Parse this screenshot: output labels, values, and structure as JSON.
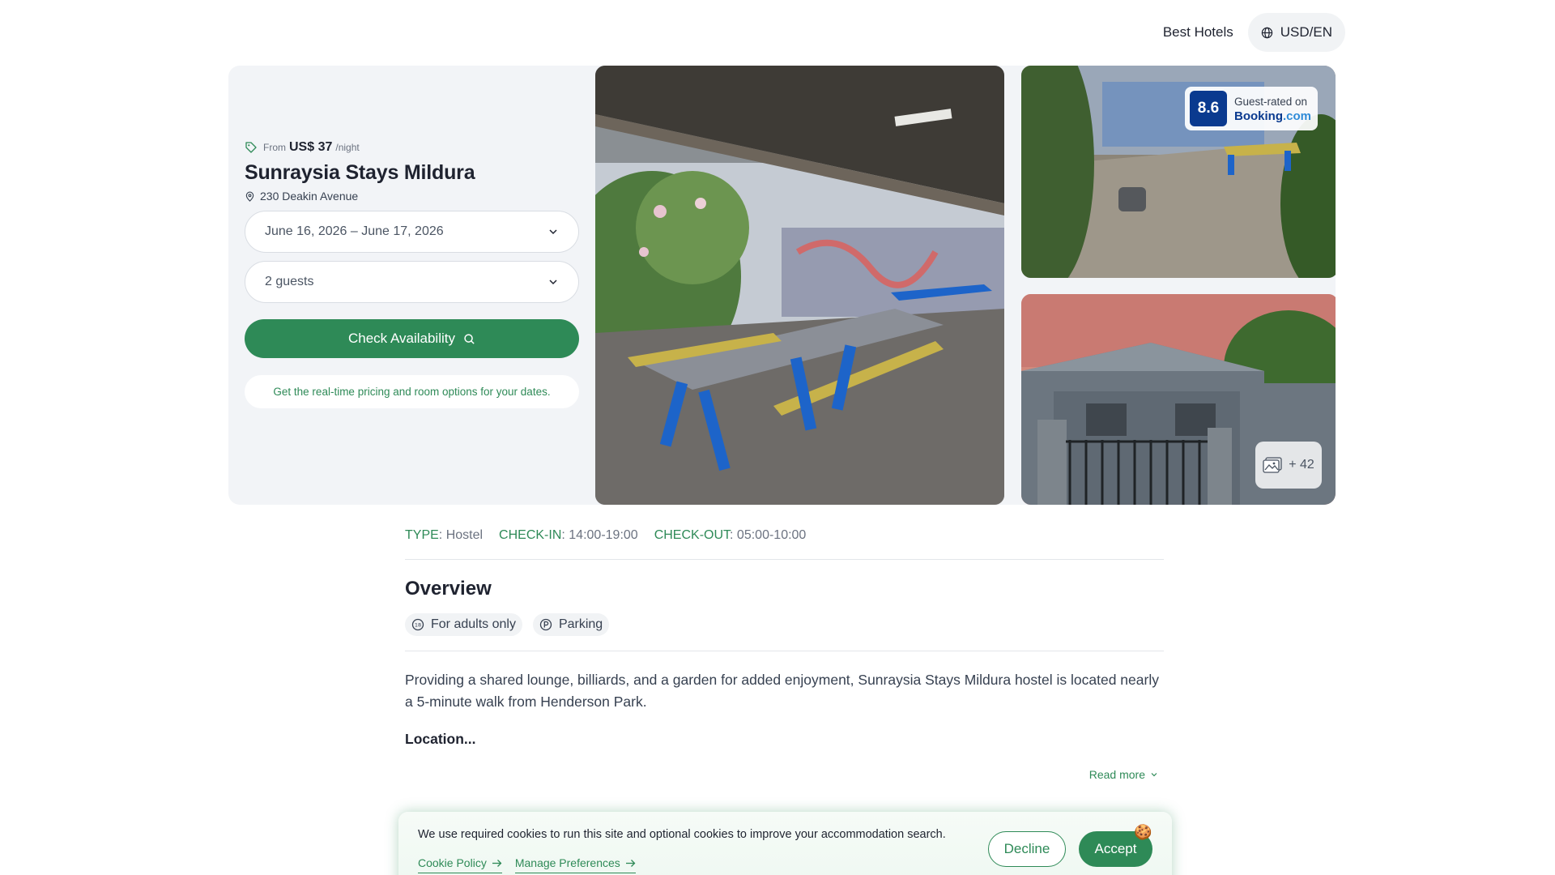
{
  "header": {
    "nav_link": "Best Hotels",
    "currency_language": "USD/EN"
  },
  "booking": {
    "price_prefix": "From",
    "price": "US$ 37",
    "price_suffix": "/night",
    "hotel_name": "Sunraysia Stays Mildura",
    "address": "230 Deakin Avenue",
    "dates_value": "June 16, 2026 – June 17, 2026",
    "guests_value": "2 guests",
    "cta_label": "Check Availability",
    "hint": "Get the real-time pricing and room options for your dates."
  },
  "gallery": {
    "rating_score": "8.6",
    "rating_label": "Guest-rated on",
    "rating_source_a": "Booking",
    "rating_source_b": ".com",
    "more_photos_label": "+ 42"
  },
  "facts": [
    {
      "key": "TYPE",
      "value": "Hostel"
    },
    {
      "key": "CHECK-IN",
      "value": "14:00-19:00"
    },
    {
      "key": "CHECK-OUT",
      "value": "05:00-10:00"
    }
  ],
  "overview": {
    "title": "Overview",
    "chips": [
      "For adults only",
      "Parking"
    ],
    "description": "Providing a shared lounge, billiards, and a garden for added enjoyment, Sunraysia Stays Mildura hostel is located nearly a 5-minute walk from Henderson Park.",
    "location_heading": "Location...",
    "read_more": "Read more"
  },
  "cookie_banner": {
    "text": "We use required cookies to run this site and optional cookies to improve your accommodation search.",
    "cookie_policy": "Cookie Policy",
    "manage_preferences": "Manage Preferences",
    "decline": "Decline",
    "accept": "Accept",
    "icon": "🍪"
  },
  "colors": {
    "accent": "#2e8a57",
    "rating_blue": "#0a3a8f",
    "hero_bg": "#f2f4f7"
  }
}
